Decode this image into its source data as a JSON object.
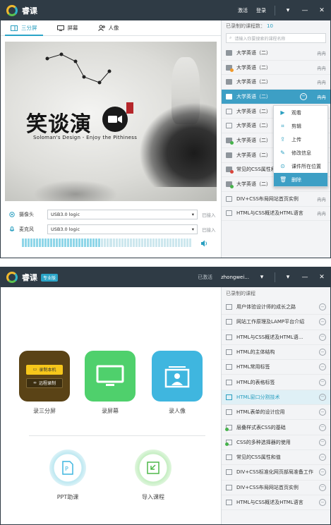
{
  "window1": {
    "app_name": "睿课",
    "titlebar": {
      "activate": "激活",
      "login": "登录",
      "menu_icon": "chevron-down-icon",
      "minimize": "—",
      "close": "✕"
    },
    "tabs": [
      {
        "label": "三分屏",
        "icon": "split-screen-icon",
        "active": true
      },
      {
        "label": "屏幕",
        "icon": "monitor-icon",
        "active": false
      },
      {
        "label": "人像",
        "icon": "portrait-icon",
        "active": false
      }
    ],
    "preview": {
      "calligraphy": "笑谈演",
      "seal": "",
      "slogan": "Soloman's Design - Enjoy the Pithiness"
    },
    "devices": [
      {
        "label": "摄像头",
        "icon": "camera-icon",
        "value": "USB3.0 logic",
        "status": "已接入"
      },
      {
        "label": "麦克风",
        "icon": "microphone-icon",
        "value": "USB3.0 logic",
        "status": "已接入"
      }
    ],
    "meter": {
      "level": 0.46
    },
    "course_panel": {
      "header": "已录制的课程数：",
      "count": "10",
      "search_placeholder": "请输入你要搜索的课程名称",
      "courses": [
        {
          "title": "大学英语（二）",
          "user": "冉冉",
          "badge": "none"
        },
        {
          "title": "大学英语（二）",
          "user": "冉冉",
          "badge": "orange"
        },
        {
          "title": "大学英语（二）",
          "user": "冉冉",
          "badge": "none"
        },
        {
          "title": "大学英语（二）",
          "user": "冉冉",
          "badge": "selected"
        },
        {
          "title": "大学英语（二）",
          "user": "冉冉",
          "badge": "mon"
        },
        {
          "title": "大学英语（二）",
          "user": "冉冉",
          "badge": "mon"
        },
        {
          "title": "大学英语（二）",
          "user": "冉冉",
          "badge": "green"
        },
        {
          "title": "大学英语（二）",
          "user": "冉冉",
          "badge": "none"
        },
        {
          "title": "常见的CSS属性和值",
          "user": "冉冉",
          "badge": "red"
        },
        {
          "title": "大学英语（二）",
          "user": "冉冉",
          "badge": "green"
        },
        {
          "title": "DIV+CSS布局网站首页实例",
          "user": "冉冉",
          "badge": "mon"
        },
        {
          "title": "HTML与CSS概述及HTML语言",
          "user": "冉冉",
          "badge": "mon"
        }
      ]
    },
    "context_menu": [
      {
        "label": "观看",
        "icon": "video-icon",
        "glyph": "▶"
      },
      {
        "label": "剪辑",
        "icon": "crop-icon",
        "glyph": "⌗"
      },
      {
        "label": "上传",
        "icon": "upload-icon",
        "glyph": "⇪"
      },
      {
        "label": "修改信息",
        "icon": "edit-icon",
        "glyph": "✎"
      },
      {
        "label": "课件所在位置",
        "icon": "location-icon",
        "glyph": "⊙"
      },
      {
        "label": "删除",
        "icon": "trash-icon",
        "glyph": "🗑",
        "active": true
      }
    ]
  },
  "window2": {
    "app_name": "睿课",
    "pro_badge": "专业版",
    "titlebar": {
      "activated": "已激活",
      "user": "zhongwei...",
      "menu_icon": "chevron-down-icon",
      "minimize": "—",
      "close": "✕"
    },
    "tiles": [
      {
        "label": "录三分屏",
        "pill1": "录制本机",
        "pill2": "远程录制",
        "color": "#5a4316"
      },
      {
        "label": "录屏幕",
        "icon": "monitor-icon",
        "color": "#4fd06c"
      },
      {
        "label": "录人像",
        "icon": "portrait-icon",
        "color": "#3fb6df"
      }
    ],
    "secondary": [
      {
        "label": "PPT助课",
        "icon": "ppt-icon"
      },
      {
        "label": "导入课程",
        "icon": "import-icon"
      }
    ],
    "course_panel": {
      "header": "已录制的课程",
      "courses": [
        {
          "title": "用户体验设计师的成长之路",
          "badge": "none"
        },
        {
          "title": "网站工作原理及LAMP平台介绍",
          "badge": "none"
        },
        {
          "title": "HTML与CSS概述及HTML语...",
          "badge": "none"
        },
        {
          "title": "HTML的主体结构",
          "badge": "none"
        },
        {
          "title": "HTML常用标签",
          "badge": "none"
        },
        {
          "title": "HTML的表格标签",
          "badge": "none"
        },
        {
          "title": "HTML窗口分割技术",
          "badge": "selected"
        },
        {
          "title": "HTML表单的设计应用",
          "badge": "none"
        },
        {
          "title": "层叠样式表CSS的基础",
          "badge": "green"
        },
        {
          "title": "CSS的多种选择器的使用",
          "badge": "green"
        },
        {
          "title": "常见的CSS属性和值",
          "badge": "none"
        },
        {
          "title": "DIV+CSS标准化网页部局准备工作",
          "badge": "none"
        },
        {
          "title": "DIV+CSS布局网站首页实例",
          "badge": "none"
        },
        {
          "title": "HTML与CSS概述及HTML语言",
          "badge": "none"
        }
      ]
    }
  }
}
